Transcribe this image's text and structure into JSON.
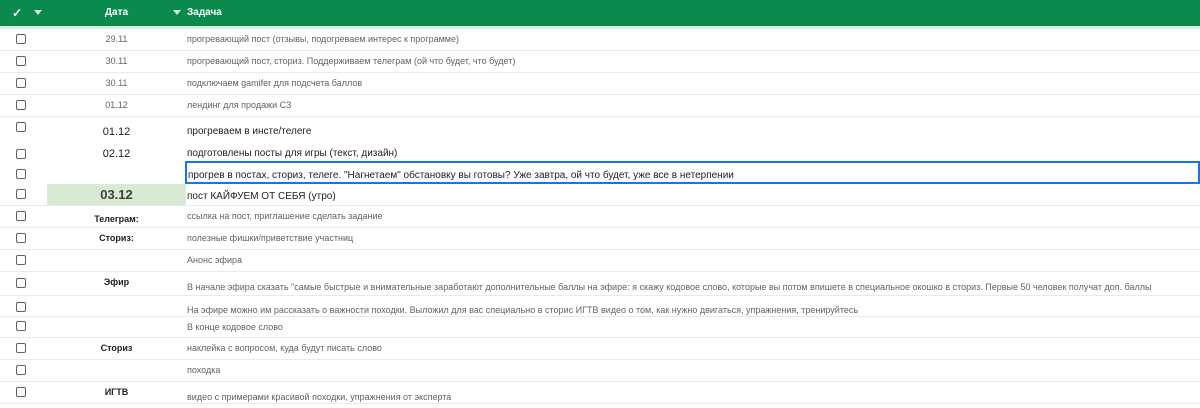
{
  "header": {
    "check_label": "✓",
    "date_label": "Дата",
    "task_label": "Задача"
  },
  "rows": [
    {
      "date": "29.11",
      "task": "прогревающий пост (отзывы, подогреваем интерес к программе)"
    },
    {
      "date": "30.11",
      "task": "прогревающий пост, сториз. Поддерживаем телеграм (ой что будет, что будет)"
    },
    {
      "date": "30.11",
      "task": "подключаем gamifer для подсчета баллов"
    },
    {
      "date": "01.12",
      "task": "лендинг для продажи СЗ"
    },
    {
      "date": "01.12",
      "task": "прогреваем в инсте/телеге"
    },
    {
      "date": "02.12",
      "task": "подготовлены посты для игры (текст, дизайн)"
    },
    {
      "date": "",
      "task": "прогрев в постах, сториз, телеге. \"Нагнетаем\" обстановку вы готовы? Уже завтра, ой что будет, уже все в нетерпении"
    },
    {
      "date": "03.12",
      "task": "пост КАЙФУЕМ ОТ СЕБЯ (утро)"
    },
    {
      "date": "Телеграм:",
      "task": " ссылка на пост, приглашение сделать задание"
    },
    {
      "date": "Сториз:",
      "task": "полезные фишки/приветствие участниц"
    },
    {
      "date": "",
      "task": "Анонс эфира"
    },
    {
      "date": "Эфир",
      "task": "В начале эфира сказать \"самые быстрые и внимательные заработают дополнительные баллы на эфире: я скажу кодовое слово, которые вы потом впишете в специальное окошко в сториз. Первые 50 человек получат доп. баллы"
    },
    {
      "date": "",
      "task": "На эфире можно им рассказать о важности походки. Выложил для вас специально в сторис ИГТВ видео о том, как нужно двигаться, упражнения, тренируйтесь"
    },
    {
      "date": "",
      "task": "В конце кодовое слово"
    },
    {
      "date": "Сториз",
      "task": "наклейка с вопросом, куда будут писать слово"
    },
    {
      "date": "",
      "task": "походка"
    },
    {
      "date": "ИГТВ",
      "task": "видео с примерами красивой походки, упражнения от эксперта"
    }
  ],
  "colors": {
    "header_bg": "#0b8a4e",
    "highlight_bg": "#d9ead3",
    "selection_border": "#1a73e8"
  }
}
